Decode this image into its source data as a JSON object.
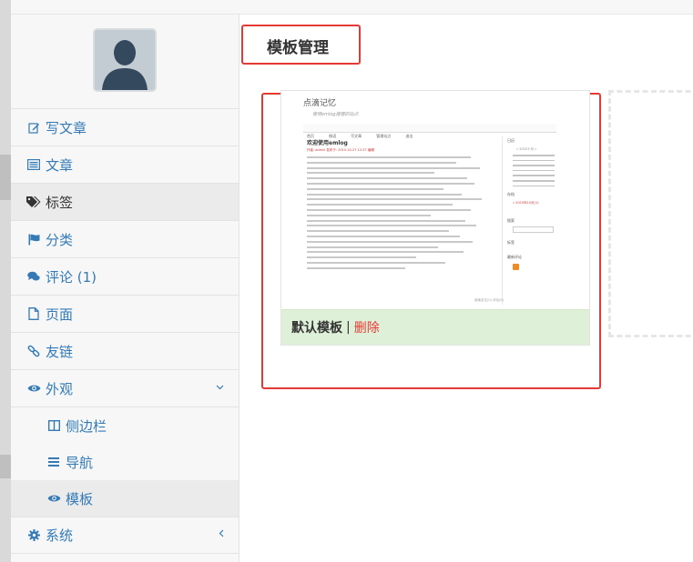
{
  "sidebar": {
    "items": [
      {
        "label": "写文章",
        "icon": "edit-icon"
      },
      {
        "label": "文章",
        "icon": "list-icon"
      },
      {
        "label": "标签",
        "icon": "tags-icon"
      },
      {
        "label": "分类",
        "icon": "flag-icon"
      },
      {
        "label": "评论 (1)",
        "icon": "comments-icon"
      },
      {
        "label": "页面",
        "icon": "file-icon"
      },
      {
        "label": "友链",
        "icon": "link-icon"
      },
      {
        "label": "外观",
        "icon": "eye-icon"
      }
    ],
    "appearance_sub": [
      {
        "label": "侧边栏",
        "icon": "columns-icon"
      },
      {
        "label": "导航",
        "icon": "bars-icon"
      },
      {
        "label": "模板",
        "icon": "eye-icon"
      }
    ],
    "system": {
      "label": "系统",
      "icon": "gear-icon"
    }
  },
  "main": {
    "title": "模板管理",
    "template": {
      "name": "默认模板",
      "separator": "|",
      "delete_label": "删除",
      "preview": {
        "site_title": "点滴记忆",
        "site_subtitle": "使用emlog搭建的站点",
        "nav": [
          "首页",
          "微语",
          "写文章",
          "管理站点",
          "退出"
        ],
        "post_title": "欢迎使用emlog",
        "post_meta": "作者: admin 发布于: 2015-10-27 12:37 编辑",
        "side_headings": [
          "日历",
          "存档",
          "搜索",
          "标签",
          "最新评论"
        ],
        "calendar_head": "« 2015十月 »",
        "archive_item": "» 2015年10月(1)",
        "more_link": "阅读全文(0) 评论(0)"
      }
    }
  },
  "colors": {
    "link": "#337ab7",
    "annotation": "#e53935",
    "footer_bg": "#dff0d8"
  }
}
